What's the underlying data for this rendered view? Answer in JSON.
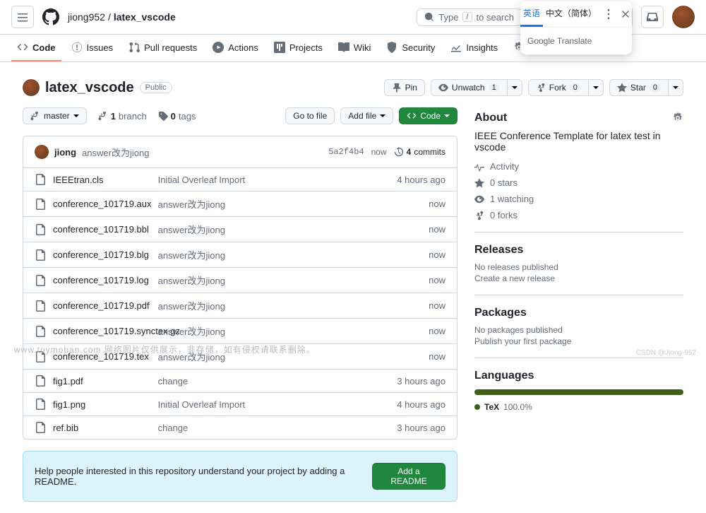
{
  "header": {
    "owner": "jiong952",
    "repo": "latex_vscode",
    "search_placeholder": "Type",
    "search_suffix": "to search",
    "search_key": "/"
  },
  "translate": {
    "tab1": "英语",
    "tab2": "中文（简体）",
    "brand_google": "Google",
    "brand_translate": "Translate"
  },
  "nav": {
    "code": "Code",
    "issues": "Issues",
    "pulls": "Pull requests",
    "actions": "Actions",
    "projects": "Projects",
    "wiki": "Wiki",
    "security": "Security",
    "insights": "Insights",
    "settings": "Settings"
  },
  "repo": {
    "name": "latex_vscode",
    "visibility": "Public",
    "pin": "Pin",
    "unwatch": "Unwatch",
    "unwatch_count": "1",
    "fork": "Fork",
    "fork_count": "0",
    "star": "Star",
    "star_count": "0"
  },
  "filebar": {
    "branch": "master",
    "branch_count": "1",
    "branch_label": "branch",
    "tag_count": "0",
    "tag_label": "tags",
    "gotofile": "Go to file",
    "addfile": "Add file",
    "code": "Code"
  },
  "commit": {
    "author": "jiong",
    "message": "answer改为jiong",
    "sha": "5a2f4b4",
    "time": "now",
    "count": "4",
    "count_label": "commits"
  },
  "files": [
    {
      "name": "IEEEtran.cls",
      "msg": "Initial Overleaf Import",
      "time": "4 hours ago"
    },
    {
      "name": "conference_101719.aux",
      "msg": "answer改为jiong",
      "time": "now"
    },
    {
      "name": "conference_101719.bbl",
      "msg": "answer改为jiong",
      "time": "now"
    },
    {
      "name": "conference_101719.blg",
      "msg": "answer改为jiong",
      "time": "now"
    },
    {
      "name": "conference_101719.log",
      "msg": "answer改为jiong",
      "time": "now"
    },
    {
      "name": "conference_101719.pdf",
      "msg": "answer改为jiong",
      "time": "now"
    },
    {
      "name": "conference_101719.synctex.gz",
      "msg": "answer改为jiong",
      "time": "now"
    },
    {
      "name": "conference_101719.tex",
      "msg": "answer改为jiong",
      "time": "now"
    },
    {
      "name": "fig1.pdf",
      "msg": "change",
      "time": "3 hours ago"
    },
    {
      "name": "fig1.png",
      "msg": "Initial Overleaf Import",
      "time": "4 hours ago"
    },
    {
      "name": "ref.bib",
      "msg": "change",
      "time": "3 hours ago"
    }
  ],
  "readme_banner": {
    "text": "Help people interested in this repository understand your project by adding a README.",
    "button": "Add a README"
  },
  "about": {
    "title": "About",
    "desc": "IEEE Conference Template for latex test in vscode",
    "activity": "Activity",
    "stars": "0 stars",
    "watching": "1 watching",
    "forks": "0 forks"
  },
  "releases": {
    "title": "Releases",
    "none": "No releases published",
    "link": "Create a new release"
  },
  "packages": {
    "title": "Packages",
    "none": "No packages published",
    "link": "Publish your first package"
  },
  "languages": {
    "title": "Languages",
    "lang": "TeX",
    "pct": "100.0%"
  },
  "footer": {
    "left": "www.toymoban.com 网络图片仅供展示，非存储，如有侵权请联系删除。",
    "right": "CSDN @Jiong-952"
  }
}
